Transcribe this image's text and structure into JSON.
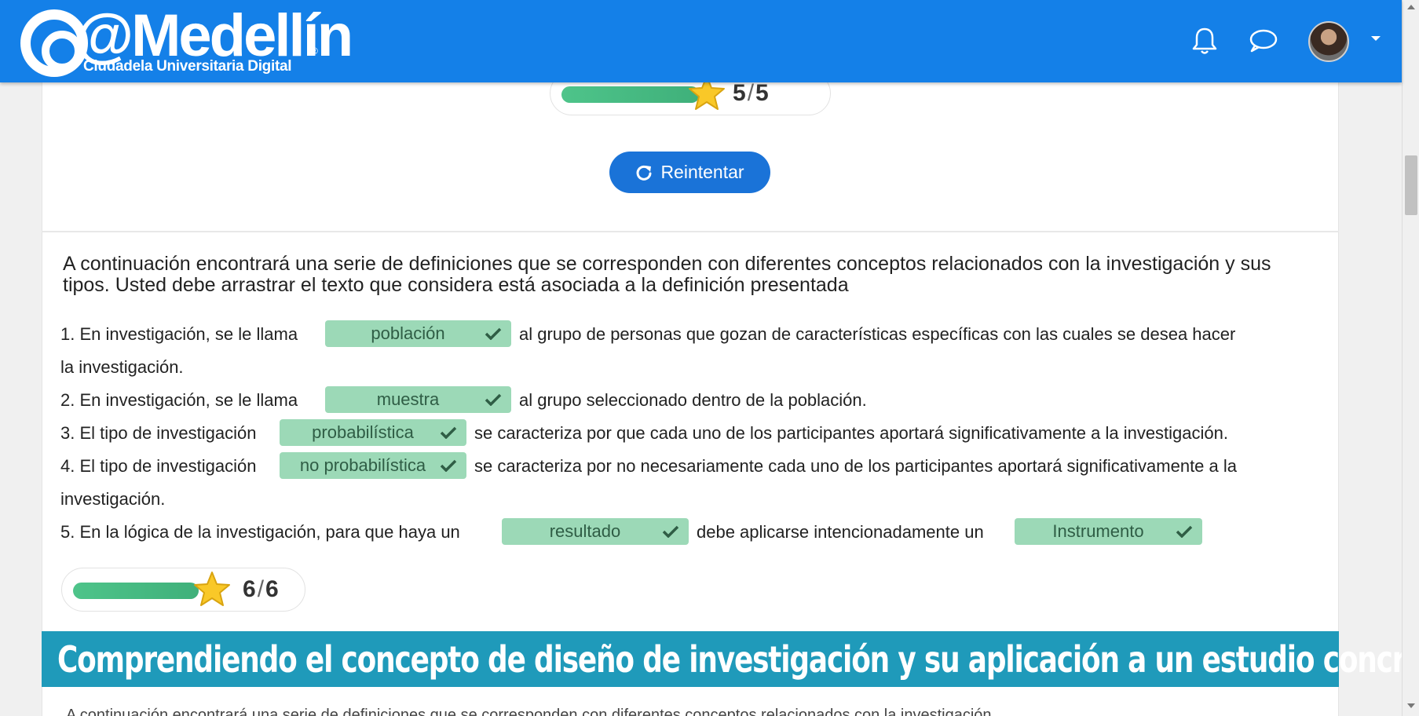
{
  "header": {
    "logo_text": "@Medellín",
    "logo_reg": "®",
    "logo_subtitle": "Ciudadela Universitaria Digital",
    "notification_icon": "bell-icon",
    "messages_icon": "chat-bubble-icon",
    "avatar_icon": "user-avatar",
    "dropdown_icon": "caret-down-icon",
    "color": "#1480e8"
  },
  "score_top": {
    "value": "5",
    "separator": "/",
    "total": "5",
    "progress": 1.0
  },
  "retry": {
    "label": "Reintentar",
    "icon": "redo-icon",
    "color": "#1a73d8"
  },
  "exercise": {
    "intro": "A continuación encontrará una serie de definiciones que se corresponden con diferentes conceptos relacionados con la investigación y sus tipos. Usted debe arrastrar el texto que considera está asociada a la definición presentada",
    "items": [
      {
        "before": "1. En investigación, se le llama",
        "answer": "población",
        "after": "al grupo de personas que gozan de características específicas con las cuales se desea hacer",
        "after2": "la investigación."
      },
      {
        "before": "2. En investigación, se le llama",
        "answer": "muestra",
        "after": "al grupo seleccionado dentro de la población."
      },
      {
        "before": "3. El tipo de investigación",
        "answer": "probabilística",
        "after": "se caracteriza por que cada uno de los participantes aportará significativamente a la investigación."
      },
      {
        "before": "4. El tipo de investigación",
        "answer": "no probabilística",
        "after": "se caracteriza por no necesariamente cada uno de los participantes aportará significativamente a la",
        "after2": "investigación."
      },
      {
        "before": "5. En la lógica de la investigación, para que haya un",
        "answer": "resultado",
        "middle": "debe aplicarse intencionadamente un",
        "answer2": "Instrumento"
      }
    ],
    "correct_color": "#9cd9b7"
  },
  "score_bottom": {
    "value": "6",
    "separator": "/",
    "total": "6",
    "progress": 1.0
  },
  "banner": {
    "title": "Comprendiendo el concepto de diseño de investigación y su aplicación a un estudio concreto",
    "color": "#1f9aba"
  },
  "cut_text": "A continuación encontrará una serie de definiciones que se corresponden con diferentes conceptos relacionados con la investigación"
}
